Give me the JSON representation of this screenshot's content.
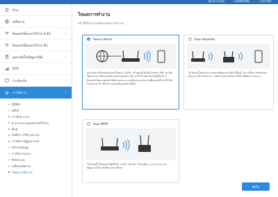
{
  "header": {
    "links": [
      "ออกจากระบบ",
      "แอพพลิเคชัน",
      "ภาษาไทย"
    ]
  },
  "sidebar": {
    "items": [
      {
        "label": "บ้าน",
        "icon": "home-icon",
        "chev": false
      },
      {
        "label": "เครือข่าย",
        "icon": "globe-icon",
        "chev": true
      },
      {
        "label": "อินเทอร์เน็ตแบบไร้สาย 2.4G",
        "icon": "wifi-icon",
        "chev": true
      },
      {
        "label": "อินเทอร์เน็ตแบบไร้สาย 5G",
        "icon": "wifi-icon",
        "chev": true
      },
      {
        "label": "อุปกรณ์เก็บข้อมูล USB",
        "icon": "usb-icon",
        "chev": true
      },
      {
        "label": "QoS",
        "icon": "qos-icon",
        "chev": false
      },
      {
        "label": "การป้องกัน",
        "icon": "shield-icon",
        "chev": true
      },
      {
        "label": "การจัดการ",
        "icon": "gear-icon",
        "chev": true
      }
    ],
    "sub_items": [
      "DDNS",
      "UPnP",
      "การตั้งค่าเวลา",
      "ตารางเวลาของอุปกรณ์ไร้สาย",
      "IPv6",
      "บันทึกการใช้งานระบบ",
      "การจัดการผู้ดูแลระบบ",
      "ปรับปรุงข้อมูล",
      "การจัดการแผน",
      "รีเซตระบบ",
      "เปลี่ยนรหัสผ่าน",
      "โหมดการทำงาน"
    ]
  },
  "main": {
    "title": "โหมดการทำงาน",
    "subtitle": "หน้านี้ใช้ในการเปลี่ยนโหมดการทำงาน",
    "modes": [
      {
        "label": "โหมดเราท์เตอร์",
        "selected": true,
        "description": "อุปกรณ์จะเชื่อมต่ออินเทอร์เน็ตผ่าน ADSL หรือเคเบิลโมเด็มโดยตรง NAT ถูกเปิดใช้งานและเครื่องคอมพิวเตอร์บนพอร์ต LAN จะใช้ IP เดียวกันกับผู้ให้บริการอินเทอร์เน็ตผ่านพอร์ต WAN และสามารถเลือกประเภทการเชื่อมต่อได้แก่ PPPoE, Dynamic IP หรือ IP แบบคงที่บนพอร์ต WAN"
      },
      {
        "label": "โหมด Repeater",
        "selected": false,
        "description": "ในโหมดนี้ คุณสามารถขยายสัญญาณ WiFi ที่มีอยู่ ในการตั้งค่า Repeater ต้องระบุ ชื่อ SSID และ รหัสผ่านของเครือข่ายไร้สายที่ต้องการขยาย"
      },
      {
        "label": "โหมด WISP",
        "selected": false,
        "description": "ในโหมดนี้ เชื่อมต่อกับผู้ให้บริการ AP / Router ไร้สายอื่น ๆ และจะกระจายสัญญาณไร้สายให้กับอุปกรณ์อื่นๆ"
      }
    ],
    "next_label": "ถัดไป"
  },
  "colors": {
    "accent": "#2d8ad9",
    "topbar": "#2d6fb5",
    "illustration_bg": "#f3f4f6"
  }
}
